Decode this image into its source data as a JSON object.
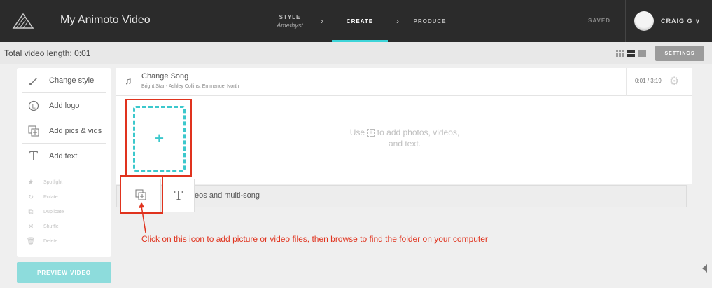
{
  "topbar": {
    "title": "My Animoto Video",
    "steps": {
      "style_label": "STYLE",
      "style_value": "Amethyst",
      "create_label": "CREATE",
      "produce_label": "PRODUCE"
    },
    "saved_label": "SAVED",
    "user_name": "CRAIG G"
  },
  "subbar": {
    "video_length": "Total video length: 0:01",
    "settings_label": "SETTINGS"
  },
  "sidebar": {
    "items": [
      {
        "label": "Change style",
        "icon": "brush-icon"
      },
      {
        "label": "Add logo",
        "icon": "logo-icon"
      },
      {
        "label": "Add pics & vids",
        "icon": "add-media-icon"
      },
      {
        "label": "Add text",
        "icon": "text-icon"
      }
    ],
    "minor_items": [
      {
        "label": "Spotlight",
        "icon": "star-icon"
      },
      {
        "label": "Rotate",
        "icon": "rotate-icon"
      },
      {
        "label": "Duplicate",
        "icon": "duplicate-icon"
      },
      {
        "label": "Shuffle",
        "icon": "shuffle-icon"
      },
      {
        "label": "Delete",
        "icon": "trash-icon"
      }
    ],
    "preview_label": "PREVIEW VIDEO"
  },
  "song": {
    "title": "Change Song",
    "artist": "Bright Star - Ashley Collins, Emmanuel North",
    "time": "0:01 / 3:19"
  },
  "canvas": {
    "hint_prefix": "Use",
    "hint_suffix": "to add photos, videos, and text."
  },
  "menu": {
    "text": "videos and multi-song"
  },
  "annotation": {
    "text": "Click on this icon to add picture or video files, then browse to find the folder on your computer",
    "color": "#e0331e"
  },
  "colors": {
    "accent": "#3dd4d8",
    "topbar_bg": "#2b2b2b",
    "annotation_red": "#e0331e"
  }
}
